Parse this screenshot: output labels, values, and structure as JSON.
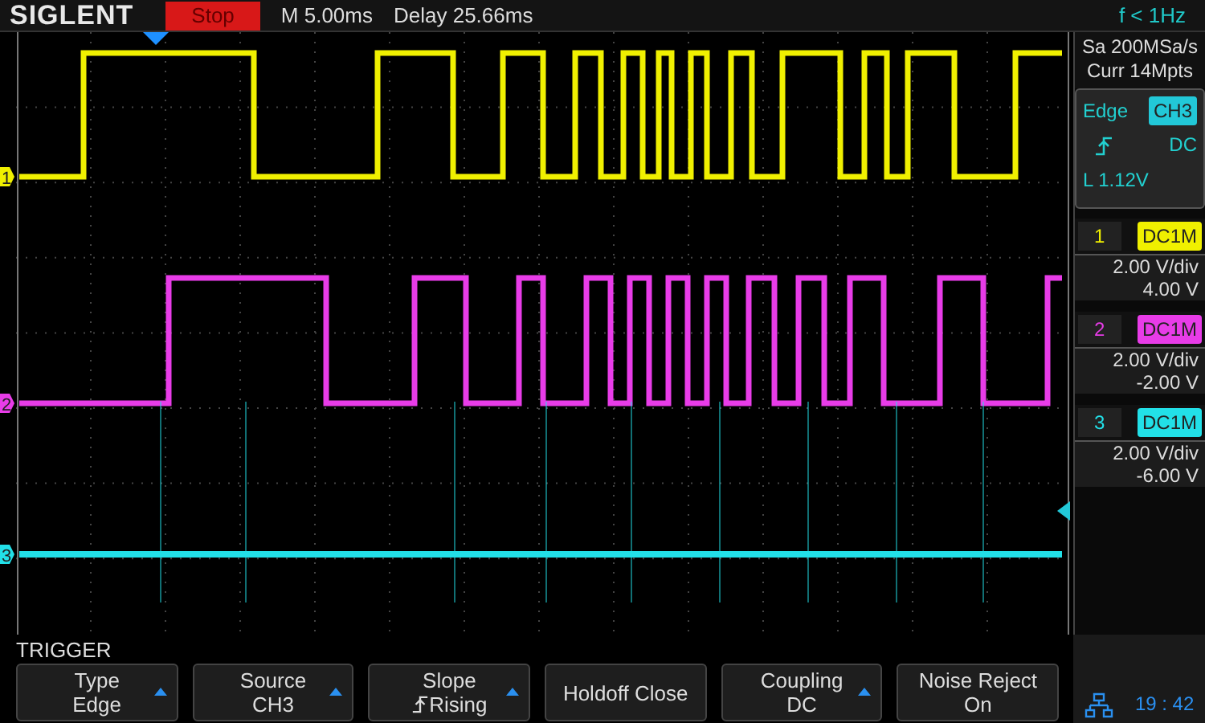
{
  "header": {
    "brand": "SIGLENT",
    "run_state": "Stop",
    "timebase": "M 5.00ms",
    "delay": "Delay 25.66ms",
    "frequency": "f < 1Hz"
  },
  "acquisition": {
    "sample_rate": "Sa 200MSa/s",
    "memory_depth": "Curr 14Mpts"
  },
  "trigger_info": {
    "type": "Edge",
    "source": "CH3",
    "coupling": "DC",
    "level": "L  1.12V"
  },
  "channels": [
    {
      "marker": "1",
      "label": "1",
      "coupling": "DC1M",
      "scale": "2.00 V/div",
      "offset": "4.00 V",
      "color": "#f0f000"
    },
    {
      "marker": "2",
      "label": "2",
      "coupling": "DC1M",
      "scale": "2.00 V/div",
      "offset": "-2.00 V",
      "color": "#e83ce8"
    },
    {
      "marker": "3",
      "label": "3",
      "coupling": "DC1M",
      "scale": "2.00 V/div",
      "offset": "-6.00 V",
      "color": "#22e0e8"
    }
  ],
  "menu": {
    "title": "TRIGGER",
    "buttons": [
      {
        "kind": "dropdown",
        "label": "Type",
        "value": "Edge"
      },
      {
        "kind": "dropdown",
        "label": "Source",
        "value": "CH3"
      },
      {
        "kind": "slope",
        "label": "Slope",
        "value": "Rising"
      },
      {
        "kind": "plain",
        "label": "Holdoff Close"
      },
      {
        "kind": "dropdown",
        "label": "Coupling",
        "value": "DC"
      },
      {
        "kind": "plain",
        "label": "Noise Reject",
        "value": "On"
      }
    ]
  },
  "status": {
    "time": "19 : 42"
  }
}
